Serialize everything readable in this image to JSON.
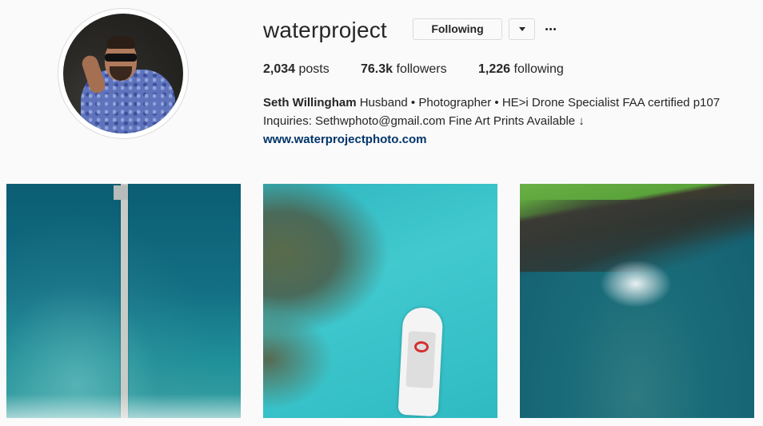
{
  "profile": {
    "username": "waterproject",
    "following_button": "Following",
    "stats": {
      "posts_count": "2,034",
      "posts_label": "posts",
      "followers_count": "76.3k",
      "followers_label": "followers",
      "following_count": "1,226",
      "following_label": "following"
    },
    "bio": {
      "name": "Seth Willingham",
      "line1": "Husband • Photographer • HE>i Drone Specialist FAA certified p107",
      "line2": "Inquiries: Sethwphoto@gmail.com Fine Art Prints Available ↓",
      "link": "www.waterprojectphoto.com"
    }
  },
  "icons": {
    "dropdown": "chevron-down-icon",
    "more": "more-options-icon"
  },
  "colors": {
    "link": "#003569",
    "background": "#fafafa",
    "border": "#dbdbdb"
  }
}
